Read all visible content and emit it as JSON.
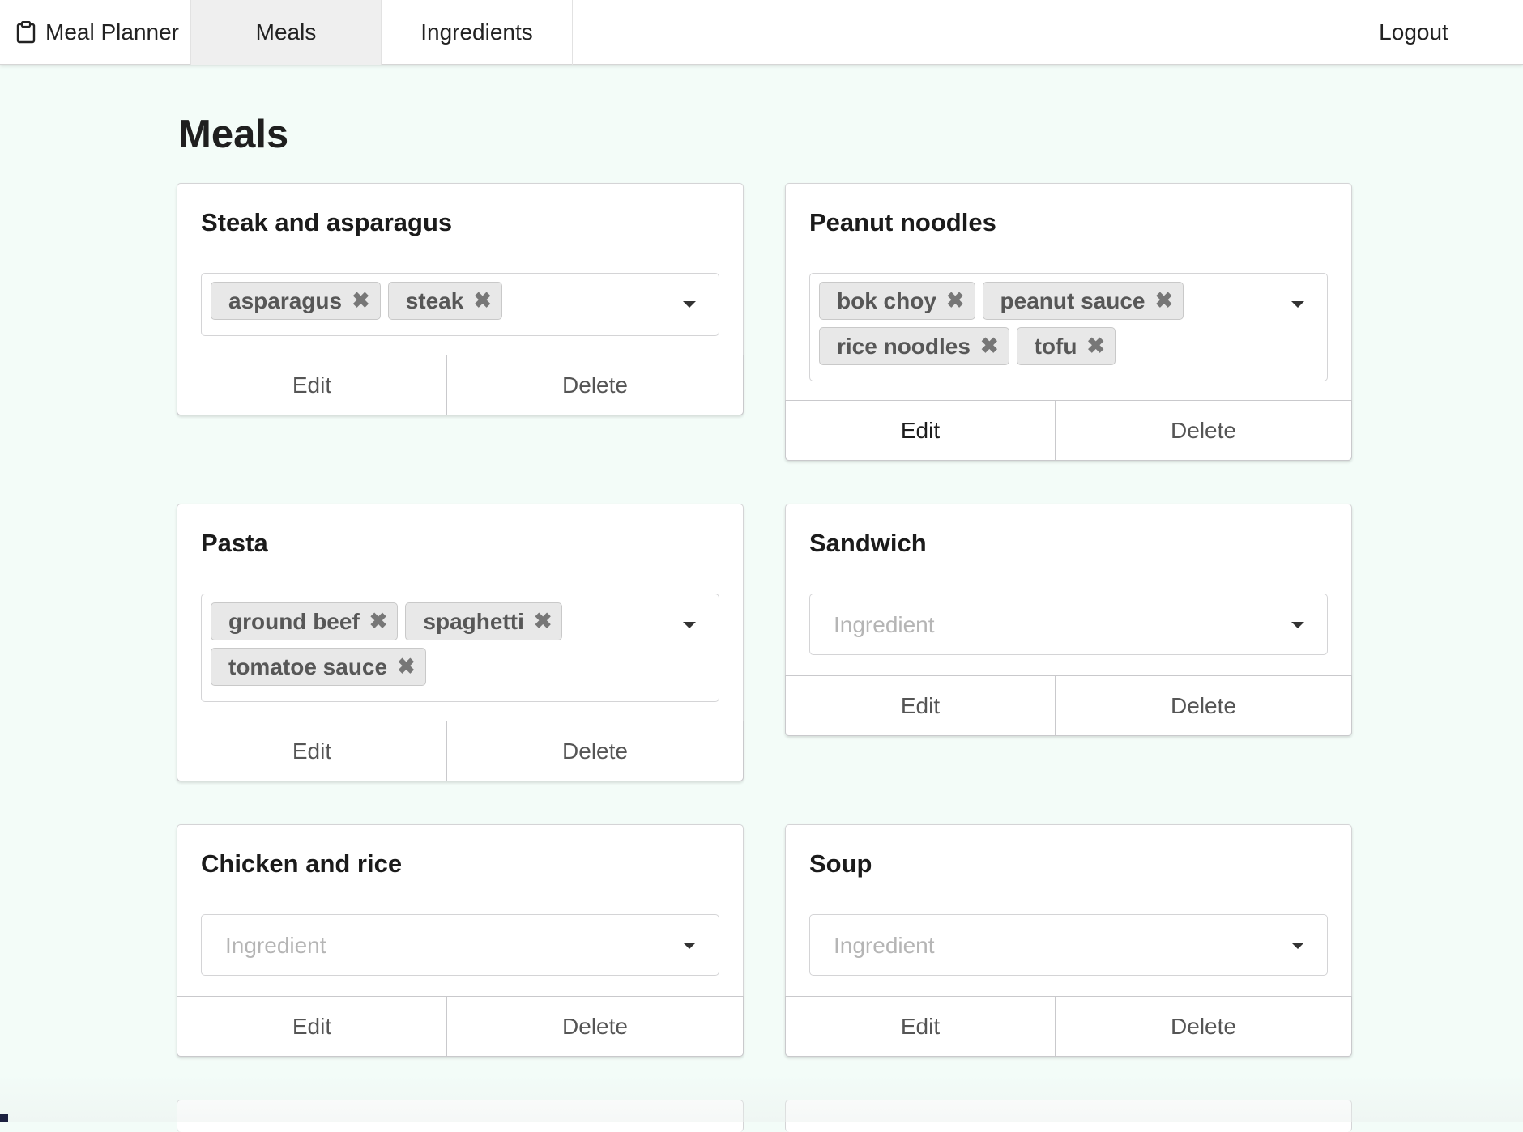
{
  "nav": {
    "brand": "Meal Planner",
    "brand_icon": "clipboard-icon",
    "meals": "Meals",
    "ingredients": "Ingredients",
    "logout": "Logout"
  },
  "page": {
    "title": "Meals"
  },
  "ui": {
    "edit": "Edit",
    "delete": "Delete",
    "placeholder": "Ingredient",
    "remove_glyph": "✖"
  },
  "meals": [
    {
      "name": "Steak and asparagus",
      "ingredients": [
        "asparagus",
        "steak"
      ]
    },
    {
      "name": "Peanut noodles",
      "ingredients": [
        "bok choy",
        "peanut sauce",
        "rice noodles",
        "tofu"
      ]
    },
    {
      "name": "Pasta",
      "ingredients": [
        "ground beef",
        "spaghetti",
        "tomatoe sauce"
      ]
    },
    {
      "name": "Sandwich",
      "ingredients": []
    },
    {
      "name": "Chicken and rice",
      "ingredients": []
    },
    {
      "name": "Soup",
      "ingredients": []
    }
  ],
  "colors": {
    "page_bg": "#f3fcf8",
    "chip_bg": "#e8e8e8",
    "border": "#d4d4d6",
    "nav_active": "#efefef"
  }
}
